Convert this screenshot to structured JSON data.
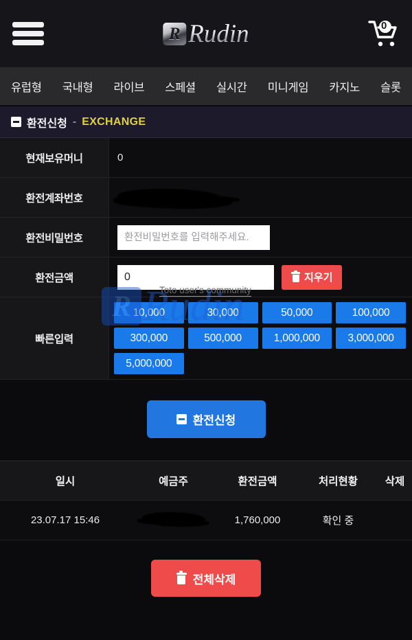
{
  "header": {
    "menu_icon": "hamburger-icon",
    "brand_mark": "R",
    "brand_name": "Rudin",
    "cart_icon": "shopping-cart-icon",
    "cart_count": "0"
  },
  "nav": {
    "items": [
      {
        "label": "유럽형"
      },
      {
        "label": "국내형"
      },
      {
        "label": "라이브"
      },
      {
        "label": "스페셜"
      },
      {
        "label": "실시간"
      },
      {
        "label": "미니게임"
      },
      {
        "label": "카지노"
      },
      {
        "label": "슬롯"
      }
    ]
  },
  "section": {
    "title_ko": "환전신청",
    "dash": "-",
    "title_en": "EXCHANGE",
    "collapse_icon": "minus-square-icon"
  },
  "form": {
    "balance_label": "현재보유머니",
    "balance_value": "0",
    "account_label": "환전계좌번호",
    "account_value": "",
    "password_label": "환전비밀번호",
    "password_placeholder": "환전비밀번호를 입력해주세요.",
    "password_value": "",
    "amount_label": "환전금액",
    "amount_value": "0",
    "clear_label": "지우기",
    "clear_icon": "trash-icon",
    "quick_label": "빠른입력",
    "quick_amounts": [
      "10,000",
      "30,000",
      "50,000",
      "100,000",
      "300,000",
      "500,000",
      "1,000,000",
      "3,000,000",
      "5,000,000"
    ]
  },
  "submit": {
    "label": "환전신청",
    "icon": "minus-square-icon"
  },
  "history": {
    "columns": [
      "일시",
      "예금주",
      "환전금액",
      "처리현황",
      "삭제"
    ],
    "rows": [
      {
        "date": "23.07.17 15:46",
        "depositor": "",
        "amount": "1,760,000",
        "status": "확인 중",
        "delete": ""
      }
    ],
    "delete_all_label": "전체삭제",
    "delete_all_icon": "trash-icon"
  },
  "watermark": {
    "mark": "R",
    "text": "Rudin",
    "subtitle": "Toto user's community"
  },
  "colors": {
    "accent_blue": "#1a7aea",
    "submit_blue": "#2276e0",
    "danger_red": "#ef4b4b",
    "section_yellow": "#ded04a",
    "page_bg": "#0b0b0d"
  }
}
